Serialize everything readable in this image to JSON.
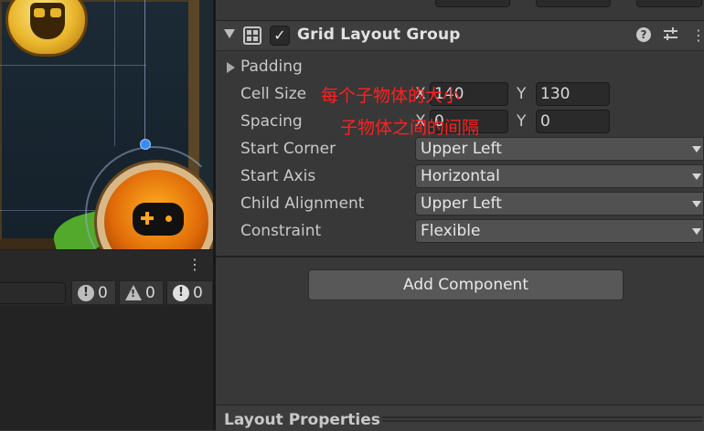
{
  "console": {
    "error_count": "0",
    "warning_count": "0",
    "info_count": "0",
    "menu_glyph": "⋮"
  },
  "inspector": {
    "component": {
      "title": "Grid Layout Group",
      "enabled_glyph": "✓",
      "help_glyph": "?",
      "menu_glyph": "⋮"
    },
    "properties": {
      "padding_label": "Padding",
      "cell_size": {
        "label": "Cell Size",
        "x_label": "X",
        "x_value": "140",
        "y_label": "Y",
        "y_value": "130"
      },
      "spacing": {
        "label": "Spacing",
        "x_label": "X",
        "x_value": "0",
        "y_label": "Y",
        "y_value": "0"
      },
      "start_corner": {
        "label": "Start Corner",
        "value": "Upper Left"
      },
      "start_axis": {
        "label": "Start Axis",
        "value": "Horizontal"
      },
      "child_alignment": {
        "label": "Child Alignment",
        "value": "Upper Left"
      },
      "constraint": {
        "label": "Constraint",
        "value": "Flexible"
      }
    },
    "annotations": {
      "cell_size_note": "每个子物体的大小",
      "spacing_note": "子物体之间的间隔"
    },
    "add_component_label": "Add Component",
    "layout_properties_title": "Layout Properties"
  },
  "colors": {
    "panel_bg": "#383838",
    "annotation_red": "#ff2020",
    "handle_blue": "#3b8cf0"
  }
}
